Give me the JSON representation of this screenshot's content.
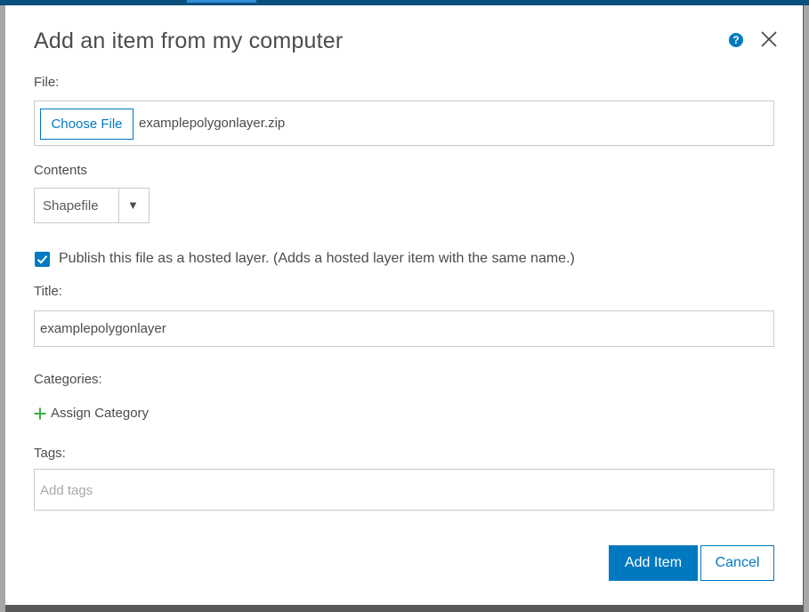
{
  "dialog": {
    "title": "Add an item from my computer",
    "help_icon": "question-circle-icon",
    "close_icon": "close-x-icon"
  },
  "file": {
    "label": "File:",
    "choose_button": "Choose File",
    "file_name": "examplepolygonlayer.zip"
  },
  "contents": {
    "label": "Contents",
    "selected": "Shapefile",
    "arrow_glyph": "▼"
  },
  "publish": {
    "checked": true,
    "label": "Publish this file as a hosted layer. (Adds a hosted layer item with the same name.)"
  },
  "title_field": {
    "label": "Title:",
    "value": "examplepolygonlayer"
  },
  "categories": {
    "label": "Categories:",
    "assign_label": "Assign Category",
    "plus_icon": "plus-icon"
  },
  "tags": {
    "label": "Tags:",
    "placeholder": "Add tags"
  },
  "actions": {
    "add_item": "Add Item",
    "cancel": "Cancel"
  },
  "colors": {
    "accent": "#0079c1",
    "plus": "#35ac46",
    "text": "#4c4c4c",
    "border": "#cacaca"
  }
}
